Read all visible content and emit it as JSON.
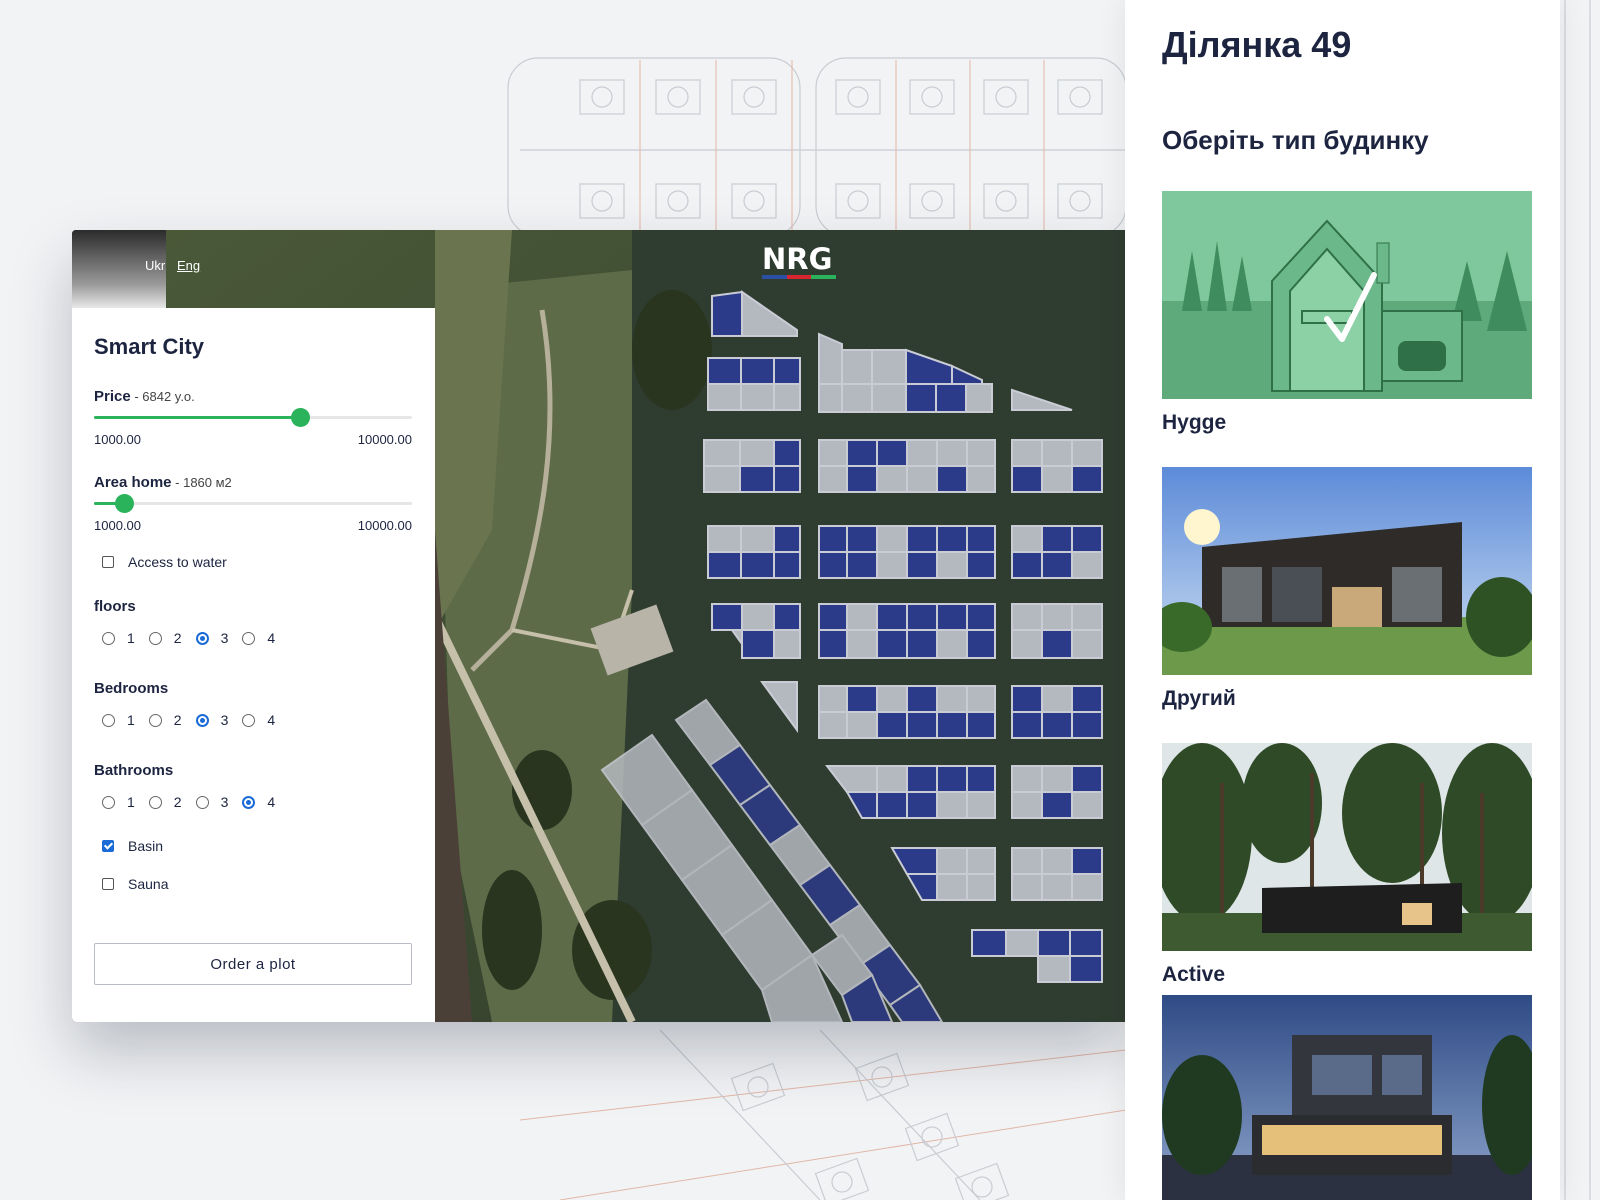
{
  "lang": {
    "ukr": "Ukr",
    "eng": "Eng"
  },
  "logo": {
    "text": "NRG",
    "colors": [
      "#2a4fa3",
      "#d7262f",
      "#2bb35b"
    ]
  },
  "filters": {
    "title": "Smart City",
    "price": {
      "label": "Price",
      "value_text": " - 6842 y.o.",
      "min": "1000.00",
      "max": "10000.00",
      "fraction": 0.6491
    },
    "area": {
      "label": "Area home",
      "value_text": " - 1860 м2",
      "min": "1000.00",
      "max": "10000.00",
      "fraction": 0.0956
    },
    "water": {
      "label": "Access to water",
      "checked": false
    },
    "floors": {
      "label": "floors",
      "options": [
        "1",
        "2",
        "3",
        "4"
      ],
      "selected": "3"
    },
    "bedrooms": {
      "label": "Bedrooms",
      "options": [
        "1",
        "2",
        "3",
        "4"
      ],
      "selected": "3"
    },
    "bathrooms": {
      "label": "Bathrooms",
      "options": [
        "1",
        "2",
        "3",
        "4"
      ],
      "selected": "4"
    },
    "basin": {
      "label": "Basin",
      "checked": true
    },
    "sauna": {
      "label": "Sauna",
      "checked": false
    },
    "order_button": "Order a plot"
  },
  "plot": {
    "title": "Ділянка 49",
    "choose_type": "Оберіть тип будинку",
    "houses": [
      {
        "name": "Hygge",
        "selected": true
      },
      {
        "name": "Другий",
        "selected": false
      },
      {
        "name": "Active",
        "selected": false
      },
      {
        "name": "",
        "selected": false
      }
    ]
  },
  "colors": {
    "accent_green": "#2bb35b",
    "selected_blue": "#1a6bd6",
    "plot_blue": "#2c3a8a",
    "text_dark": "#1c2440"
  }
}
